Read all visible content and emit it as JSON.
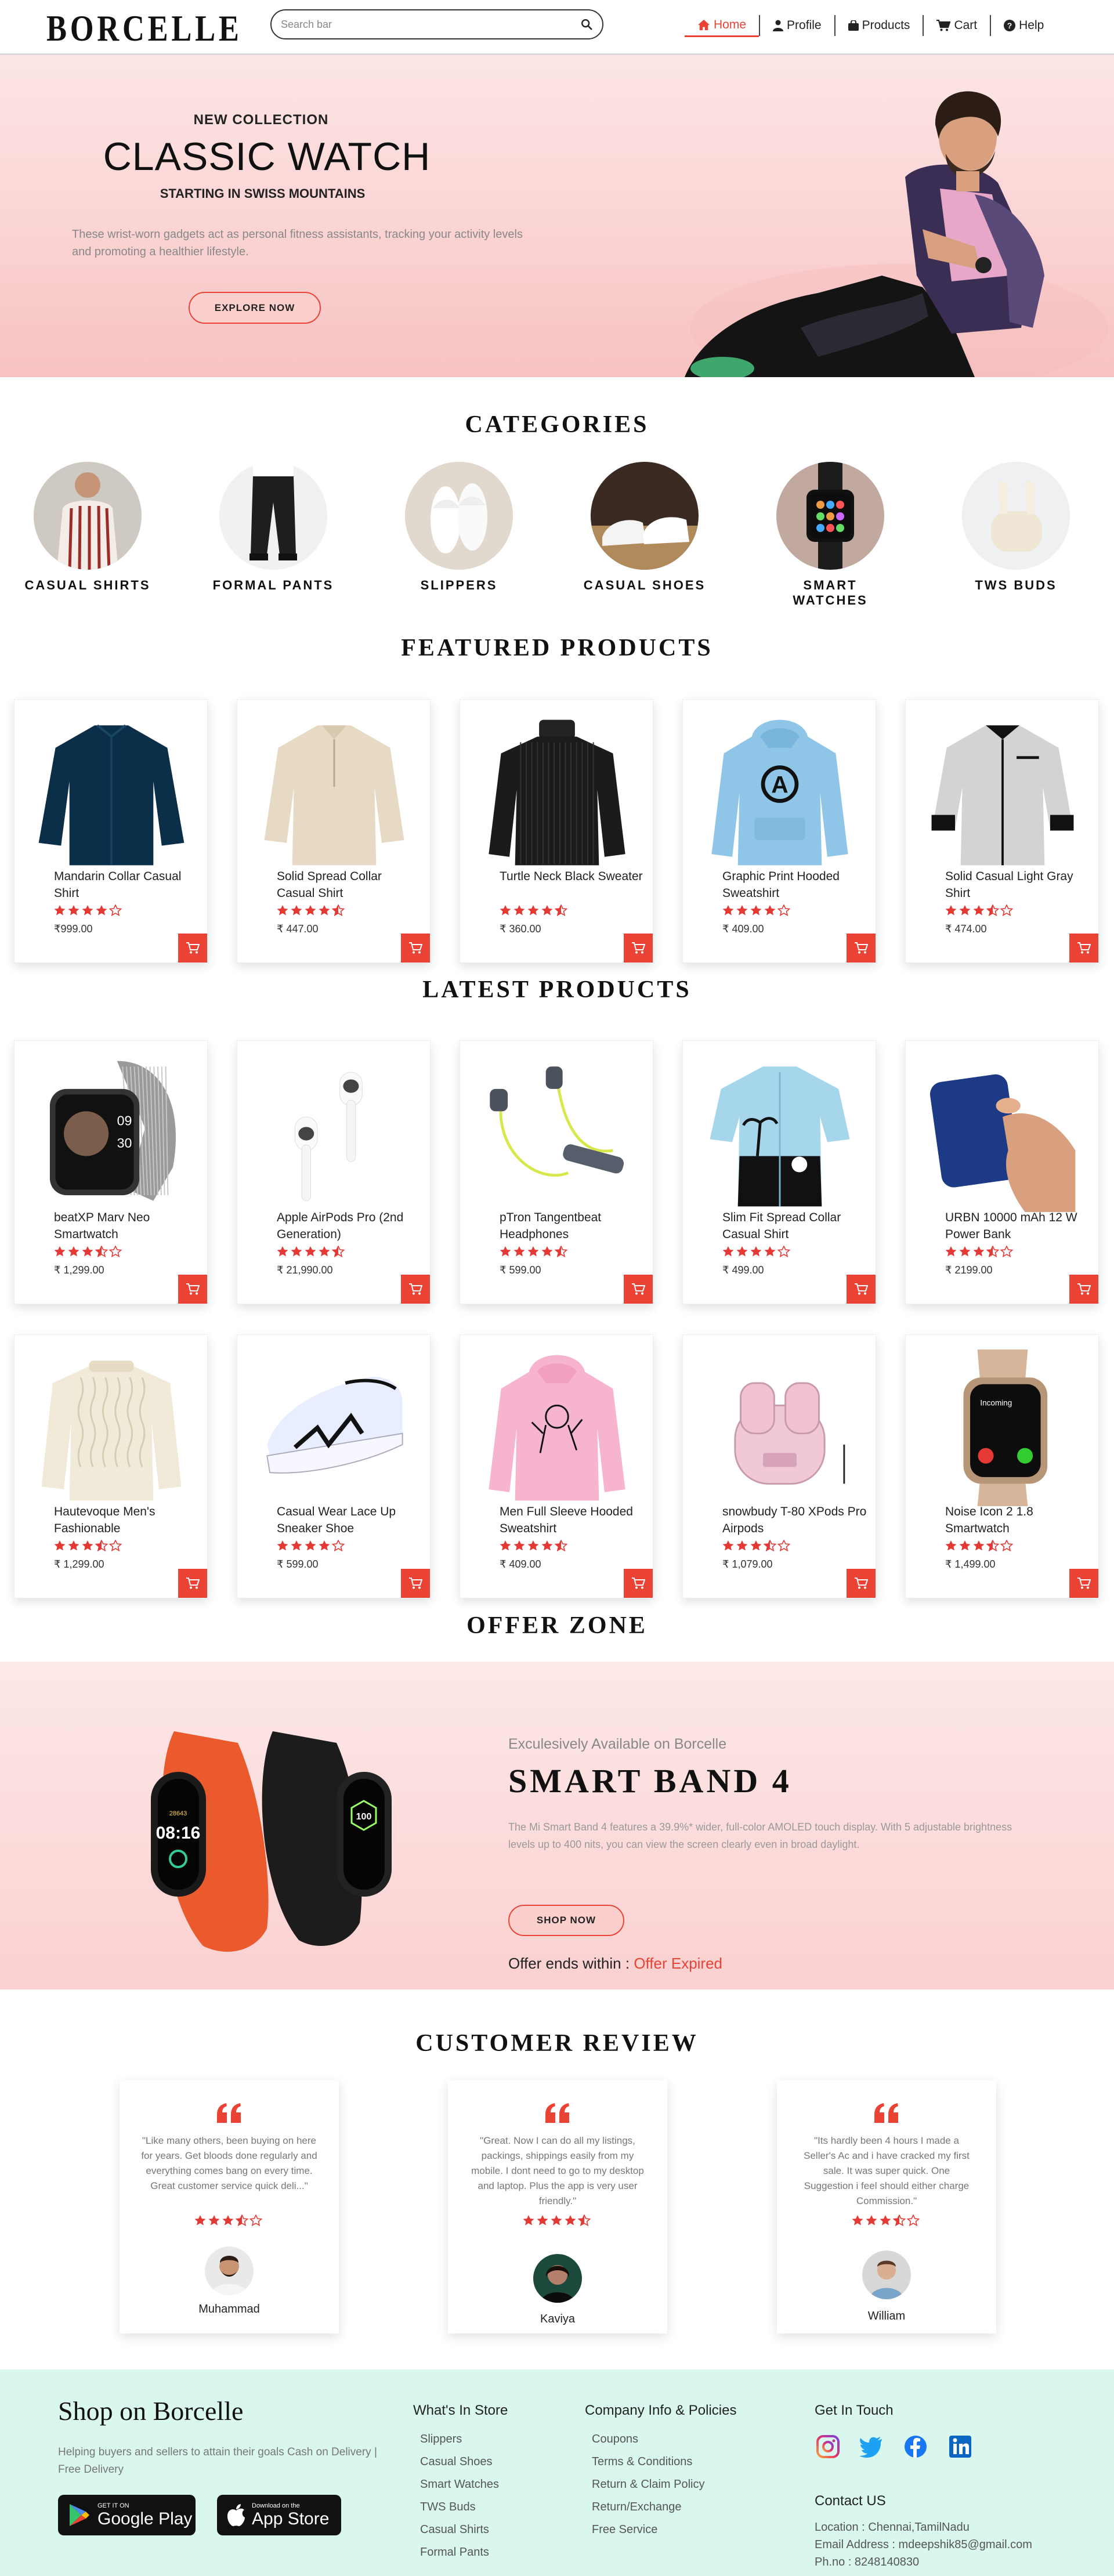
{
  "header": {
    "logo": "BORCELLE",
    "search_placeholder": "Search bar",
    "nav": [
      {
        "label": "Home",
        "icon": "home-icon"
      },
      {
        "label": "Profile",
        "icon": "user-icon"
      },
      {
        "label": "Products",
        "icon": "bag-icon"
      },
      {
        "label": "Cart",
        "icon": "cart-icon"
      },
      {
        "label": "Help",
        "icon": "help-icon"
      }
    ]
  },
  "hero": {
    "kicker": "NEW COLLECTION",
    "title": "CLASSIC WATCH",
    "subtitle": "STARTING IN SWISS MOUNTAINS",
    "description": "These wrist-worn gadgets act as personal fitness assistants, tracking your activity levels and promoting a healthier lifestyle.",
    "cta": "EXPLORE NOW"
  },
  "categories": {
    "title": "CATEGORIES",
    "items": [
      "CASUAL SHIRTS",
      "FORMAL PANTS",
      "SLIPPERS",
      "CASUAL SHOES",
      "SMART WATCHES",
      "TWS BUDS"
    ]
  },
  "featured": {
    "title": "FEATURED PRODUCTS",
    "items": [
      {
        "name": "Mandarin Collar Casual Shirt",
        "rating": 4,
        "price": "₹999.00"
      },
      {
        "name": "Solid Spread Collar Casual Shirt",
        "rating": 4.5,
        "price": "₹ 447.00"
      },
      {
        "name": "Turtle Neck Black Sweater",
        "rating": 4.5,
        "price": "₹ 360.00"
      },
      {
        "name": "Graphic Print Hooded Sweatshirt",
        "rating": 4,
        "price": "₹ 409.00"
      },
      {
        "name": "Solid Casual Light Gray Shirt",
        "rating": 3.5,
        "price": "₹ 474.00"
      }
    ]
  },
  "latest": {
    "title": "LATEST PRODUCTS",
    "items": [
      {
        "name": "beatXP Marv Neo Smartwatch",
        "rating": 3.5,
        "price": "₹ 1,299.00"
      },
      {
        "name": "Apple AirPods Pro (2nd Generation)",
        "rating": 4.5,
        "price": "₹ 21,990.00"
      },
      {
        "name": "pTron Tangentbeat Headphones",
        "rating": 4.5,
        "price": "₹ 599.00"
      },
      {
        "name": "Slim Fit Spread Collar Casual Shirt",
        "rating": 4,
        "price": "₹ 499.00"
      },
      {
        "name": "URBN 10000 mAh 12 W Power Bank",
        "rating": 3.5,
        "price": "₹ 2199.00"
      },
      {
        "name": "Hautevoque Men's Fashionable",
        "rating": 3.5,
        "price": "₹ 1,299.00"
      },
      {
        "name": "Casual Wear Lace Up Sneaker Shoe",
        "rating": 4,
        "price": "₹ 599.00"
      },
      {
        "name": "Men Full Sleeve Hooded Sweatshirt",
        "rating": 4.5,
        "price": "₹ 409.00"
      },
      {
        "name": "snowbudy T-80 XPods Pro Airpods",
        "rating": 3.5,
        "price": "₹ 1,079.00"
      },
      {
        "name": "Noise Icon 2 1.8 Smartwatch",
        "rating": 3.5,
        "price": "₹ 1,499.00"
      }
    ]
  },
  "offer": {
    "title": "OFFER ZONE",
    "exclusive": "Exculesively Available on Borcelle",
    "product": "SMART BAND 4",
    "description": "The Mi Smart Band 4 features a 39.9%* wider, full-color AMOLED touch display. With 5 adjustable brightness levels up to 400 nits, you can view the screen clearly even in broad daylight.",
    "cta": "SHOP NOW",
    "ends_label": "Offer ends within :",
    "ends_value": "Offer Expired",
    "band_left_time": "08:16",
    "band_right_value": "100"
  },
  "reviews": {
    "title": "CUSTOMER REVIEW",
    "items": [
      {
        "text": "\"Like many others, been buying on here for years. Get bloods done regularly and everything comes bang on every time. Great customer service quick deli...\"",
        "rating": 3.5,
        "name": "Muhammad"
      },
      {
        "text": "\"Great. Now I can do all my listings, packings, shippings easily from my mobile. I dont need to go to my desktop and laptop. Plus the app is very user friendly.\"",
        "rating": 4.5,
        "name": "Kaviya"
      },
      {
        "text": "\"Its hardly been 4 hours I made a Seller's Ac and i have cracked my first sale. It was super quick. One Suggestion i feel should either charge Commission.\"",
        "rating": 3.5,
        "name": "William"
      }
    ]
  },
  "footer": {
    "title": "Shop on Borcelle",
    "tagline": "Helping buyers and sellers to attain their goals Cash on Delivery | Free Delivery",
    "google_small": "GET IT ON",
    "google_big": "Google Play",
    "apple_small": "Download on the",
    "apple_big": "App Store",
    "store_heading": "What's In Store",
    "store_links": [
      "Slippers",
      "Casual Shoes",
      "Smart Watches",
      "TWS Buds",
      "Casual Shirts",
      "Formal Pants"
    ],
    "company_heading": "Company Info & Policies",
    "company_links": [
      "Coupons",
      "Terms & Conditions",
      "Return & Claim Policy",
      "Return/Exchange",
      "Free Service"
    ],
    "touch_heading": "Get In Touch",
    "contact_heading": "Contact US",
    "location": "Location : Chennai,TamilNadu",
    "email": "Email Address : mdeepshik85@gmail.com",
    "phone": "Ph.no : 8248140830"
  },
  "colors": {
    "accent": "#ea4335",
    "hero_bg": "#fbd3d3",
    "footer_bg": "#d9f7ef"
  }
}
